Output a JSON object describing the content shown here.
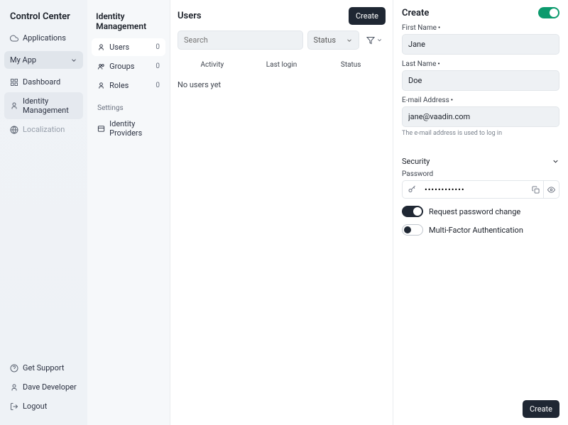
{
  "sidebar": {
    "title": "Control Center",
    "applications_label": "Applications",
    "app_dropdown": "My App",
    "items": [
      {
        "label": "Dashboard"
      },
      {
        "label": "Identity Management"
      },
      {
        "label": "Localization"
      }
    ],
    "footer": [
      {
        "label": "Get Support"
      },
      {
        "label": "Dave Developer"
      },
      {
        "label": "Logout"
      }
    ]
  },
  "secondary": {
    "title": "Identity Management",
    "items": [
      {
        "label": "Users",
        "count": "0"
      },
      {
        "label": "Groups",
        "count": "0"
      },
      {
        "label": "Roles",
        "count": "0"
      }
    ],
    "settings_heading": "Settings",
    "settings_items": [
      {
        "label": "Identity Providers"
      }
    ]
  },
  "main": {
    "title": "Users",
    "create_label": "Create",
    "search_placeholder": "Search",
    "status_label": "Status",
    "columns": [
      "Activity",
      "Last login",
      "Status"
    ],
    "empty_text": "No users yet"
  },
  "detail": {
    "title": "Create",
    "enabled": true,
    "first_name_label": "First Name",
    "first_name_value": "Jane",
    "last_name_label": "Last Name",
    "last_name_value": "Doe",
    "email_label": "E-mail Address",
    "email_value": "jane@vaadin.com",
    "email_help": "The e-mail address is used to log in",
    "security_label": "Security",
    "password_label": "Password",
    "password_value": "••••••••••••",
    "req_pwd_change_label": "Request password change",
    "mfa_label": "Multi-Factor Authentication",
    "create_button": "Create"
  }
}
